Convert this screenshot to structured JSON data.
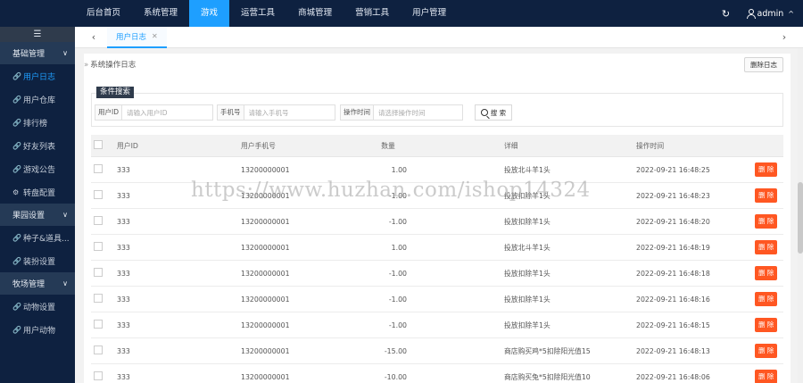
{
  "topnav": {
    "items": [
      "后台首页",
      "系统管理",
      "游戏",
      "运营工具",
      "商城管理",
      "营销工具",
      "用户管理"
    ],
    "active_index": 2,
    "user": "admin"
  },
  "sidebar": {
    "groups": [
      {
        "label": "基础管理",
        "items": [
          {
            "label": "用户日志",
            "icon": "link-icon",
            "active": true
          },
          {
            "label": "用户仓库",
            "icon": "link-icon"
          },
          {
            "label": "排行榜",
            "icon": "link-icon"
          },
          {
            "label": "好友列表",
            "icon": "link-icon"
          },
          {
            "label": "游戏公告",
            "icon": "link-icon"
          },
          {
            "label": "转盘配置",
            "icon": "settings-icon"
          }
        ]
      },
      {
        "label": "果园设置",
        "items": [
          {
            "label": "种子&道具...",
            "icon": "link-icon"
          },
          {
            "label": "装扮设置",
            "icon": "link-icon"
          }
        ]
      },
      {
        "label": "牧场管理",
        "items": [
          {
            "label": "动物设置",
            "icon": "link-icon"
          },
          {
            "label": "用户动物",
            "icon": "link-icon"
          }
        ]
      }
    ]
  },
  "tabbar": {
    "active_tab": "用户日志"
  },
  "page": {
    "breadcrumb": "系统操作日志",
    "clear_button": "删除日志",
    "search": {
      "legend": "条件搜索",
      "uid_label": "用户ID",
      "uid_placeholder": "请输入用户ID",
      "phone_label": "手机号",
      "phone_placeholder": "请输入手机号",
      "time_label": "操作时间",
      "time_placeholder": "请选择操作时间",
      "button": "搜 索"
    },
    "table": {
      "headers": [
        "用户ID",
        "用户手机号",
        "数量",
        "详细",
        "操作时间",
        ""
      ],
      "delete_label": "删 除",
      "rows": [
        {
          "uid": "333",
          "phone": "13200000001",
          "num": "1.00",
          "desc": "投放北斗羊1头",
          "time": "2022-09-21 16:48:25"
        },
        {
          "uid": "333",
          "phone": "13200000001",
          "num": "-1.00",
          "desc": "投放扣除羊1头",
          "time": "2022-09-21 16:48:23"
        },
        {
          "uid": "333",
          "phone": "13200000001",
          "num": "-1.00",
          "desc": "投放扣除羊1头",
          "time": "2022-09-21 16:48:20"
        },
        {
          "uid": "333",
          "phone": "13200000001",
          "num": "1.00",
          "desc": "投放北斗羊1头",
          "time": "2022-09-21 16:48:19"
        },
        {
          "uid": "333",
          "phone": "13200000001",
          "num": "-1.00",
          "desc": "投放扣除羊1头",
          "time": "2022-09-21 16:48:18"
        },
        {
          "uid": "333",
          "phone": "13200000001",
          "num": "-1.00",
          "desc": "投放扣除羊1头",
          "time": "2022-09-21 16:48:16"
        },
        {
          "uid": "333",
          "phone": "13200000001",
          "num": "-1.00",
          "desc": "投放扣除羊1头",
          "time": "2022-09-21 16:48:15"
        },
        {
          "uid": "333",
          "phone": "13200000001",
          "num": "-15.00",
          "desc": "商店购买鸡*5扣除阳光值15",
          "time": "2022-09-21 16:48:13"
        },
        {
          "uid": "333",
          "phone": "13200000001",
          "num": "-10.00",
          "desc": "商店购买兔*5扣除阳光值10",
          "time": "2022-09-21 16:48:06"
        }
      ]
    }
  },
  "watermark": "https://www.huzhan.com/ishop14324",
  "colors": {
    "nav_bg": "#0e2140",
    "accent": "#1e9fff",
    "danger": "#ff5722"
  }
}
